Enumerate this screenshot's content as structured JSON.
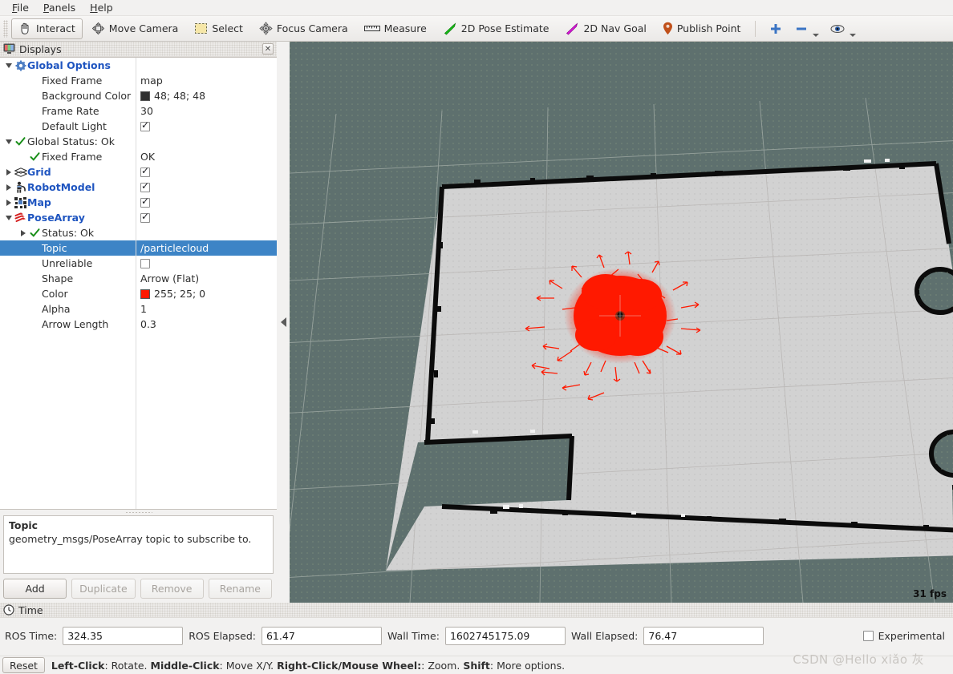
{
  "menubar": {
    "items": [
      {
        "label": "File",
        "accel": "F"
      },
      {
        "label": "Panels",
        "accel": "P"
      },
      {
        "label": "Help",
        "accel": "H"
      }
    ]
  },
  "toolbar": {
    "buttons": [
      {
        "label": "Interact",
        "icon": "hand-icon",
        "active": true
      },
      {
        "label": "Move Camera",
        "icon": "move-camera-icon",
        "active": false
      },
      {
        "label": "Select",
        "icon": "select-rect-icon",
        "active": false
      },
      {
        "label": "Focus Camera",
        "icon": "focus-camera-icon",
        "active": false
      },
      {
        "label": "Measure",
        "icon": "ruler-icon",
        "active": false
      },
      {
        "label": "2D Pose Estimate",
        "icon": "green-arrow-icon",
        "active": false
      },
      {
        "label": "2D Nav Goal",
        "icon": "magenta-arrow-icon",
        "active": false
      },
      {
        "label": "Publish Point",
        "icon": "map-pin-icon",
        "active": false
      }
    ],
    "extra": [
      {
        "name": "add-tool-button",
        "icon": "plus-icon"
      },
      {
        "name": "remove-tool-button",
        "icon": "minus-icon"
      },
      {
        "name": "visibility-button",
        "icon": "eye-icon"
      }
    ]
  },
  "displays": {
    "title": "Displays",
    "close_label": "✕",
    "rows": [
      {
        "indent": 0,
        "twisty": "down",
        "icon": "gear-icon",
        "label": "Global Options",
        "bold": true,
        "value_kind": "none"
      },
      {
        "indent": 1,
        "twisty": "none",
        "icon": "none",
        "label": "Fixed Frame",
        "bold": false,
        "value_kind": "text",
        "value": "map"
      },
      {
        "indent": 1,
        "twisty": "none",
        "icon": "none",
        "label": "Background Color",
        "bold": false,
        "value_kind": "color",
        "value": "48; 48; 48",
        "color": "#303030"
      },
      {
        "indent": 1,
        "twisty": "none",
        "icon": "none",
        "label": "Frame Rate",
        "bold": false,
        "value_kind": "text",
        "value": "30"
      },
      {
        "indent": 1,
        "twisty": "none",
        "icon": "none",
        "label": "Default Light",
        "bold": false,
        "value_kind": "check",
        "checked": true
      },
      {
        "indent": 0,
        "twisty": "down",
        "icon": "check-icon",
        "label": "Global Status: Ok",
        "bold": false,
        "value_kind": "none"
      },
      {
        "indent": 1,
        "twisty": "none",
        "icon": "check-icon",
        "label": "Fixed Frame",
        "bold": false,
        "value_kind": "text",
        "value": "OK"
      },
      {
        "indent": 0,
        "twisty": "right",
        "icon": "grid-icon",
        "label": "Grid",
        "bold": true,
        "value_kind": "check",
        "checked": true
      },
      {
        "indent": 0,
        "twisty": "right",
        "icon": "robotmodel-icon",
        "label": "RobotModel",
        "bold": true,
        "value_kind": "check",
        "checked": true
      },
      {
        "indent": 0,
        "twisty": "right",
        "icon": "map-icon",
        "label": "Map",
        "bold": true,
        "value_kind": "check",
        "checked": true
      },
      {
        "indent": 0,
        "twisty": "down",
        "icon": "posearray-icon",
        "label": "PoseArray",
        "bold": true,
        "value_kind": "check",
        "checked": true
      },
      {
        "indent": 1,
        "twisty": "right",
        "icon": "check-icon",
        "label": "Status: Ok",
        "bold": false,
        "value_kind": "none"
      },
      {
        "indent": 1,
        "twisty": "none",
        "icon": "none",
        "label": "Topic",
        "bold": false,
        "value_kind": "text",
        "value": "/particlecloud",
        "selected": true
      },
      {
        "indent": 1,
        "twisty": "none",
        "icon": "none",
        "label": "Unreliable",
        "bold": false,
        "value_kind": "check",
        "checked": false
      },
      {
        "indent": 1,
        "twisty": "none",
        "icon": "none",
        "label": "Shape",
        "bold": false,
        "value_kind": "text",
        "value": "Arrow (Flat)"
      },
      {
        "indent": 1,
        "twisty": "none",
        "icon": "none",
        "label": "Color",
        "bold": false,
        "value_kind": "color",
        "value": "255; 25; 0",
        "color": "#ff1900"
      },
      {
        "indent": 1,
        "twisty": "none",
        "icon": "none",
        "label": "Alpha",
        "bold": false,
        "value_kind": "text",
        "value": "1"
      },
      {
        "indent": 1,
        "twisty": "none",
        "icon": "none",
        "label": "Arrow Length",
        "bold": false,
        "value_kind": "text",
        "value": "0.3"
      }
    ],
    "help": {
      "title": "Topic",
      "body": "geometry_msgs/PoseArray topic to subscribe to."
    },
    "buttons": [
      {
        "label": "Add",
        "enabled": true
      },
      {
        "label": "Duplicate",
        "enabled": false
      },
      {
        "label": "Remove",
        "enabled": false
      },
      {
        "label": "Rename",
        "enabled": false
      }
    ]
  },
  "view3d": {
    "background_color": "#5e706e",
    "free_space_color": "#d0d0d0",
    "occupied_color": "#0a0a0a",
    "particle_color": "#ff1900",
    "fps": "31 fps"
  },
  "time": {
    "title": "Time",
    "fields": [
      {
        "label": "ROS Time:",
        "value": "324.35",
        "width": 150
      },
      {
        "label": "ROS Elapsed:",
        "value": "61.47",
        "width": 150
      },
      {
        "label": "Wall Time:",
        "value": "1602745175.09",
        "width": 150
      },
      {
        "label": "Wall Elapsed:",
        "value": "76.47",
        "width": 150
      }
    ],
    "experimental_label": "Experimental",
    "experimental_checked": false
  },
  "statusbar": {
    "reset_label": "Reset",
    "hint_parts": [
      {
        "text": "Left-Click",
        "bold": true
      },
      {
        "text": ": Rotate. ",
        "bold": false
      },
      {
        "text": "Middle-Click",
        "bold": true
      },
      {
        "text": ": Move X/Y. ",
        "bold": false
      },
      {
        "text": "Right-Click/Mouse Wheel:",
        "bold": true
      },
      {
        "text": ": Zoom. ",
        "bold": false
      },
      {
        "text": "Shift",
        "bold": true
      },
      {
        "text": ": More options.",
        "bold": false
      }
    ]
  },
  "watermark": "CSDN @Hello xiǎo 灰"
}
